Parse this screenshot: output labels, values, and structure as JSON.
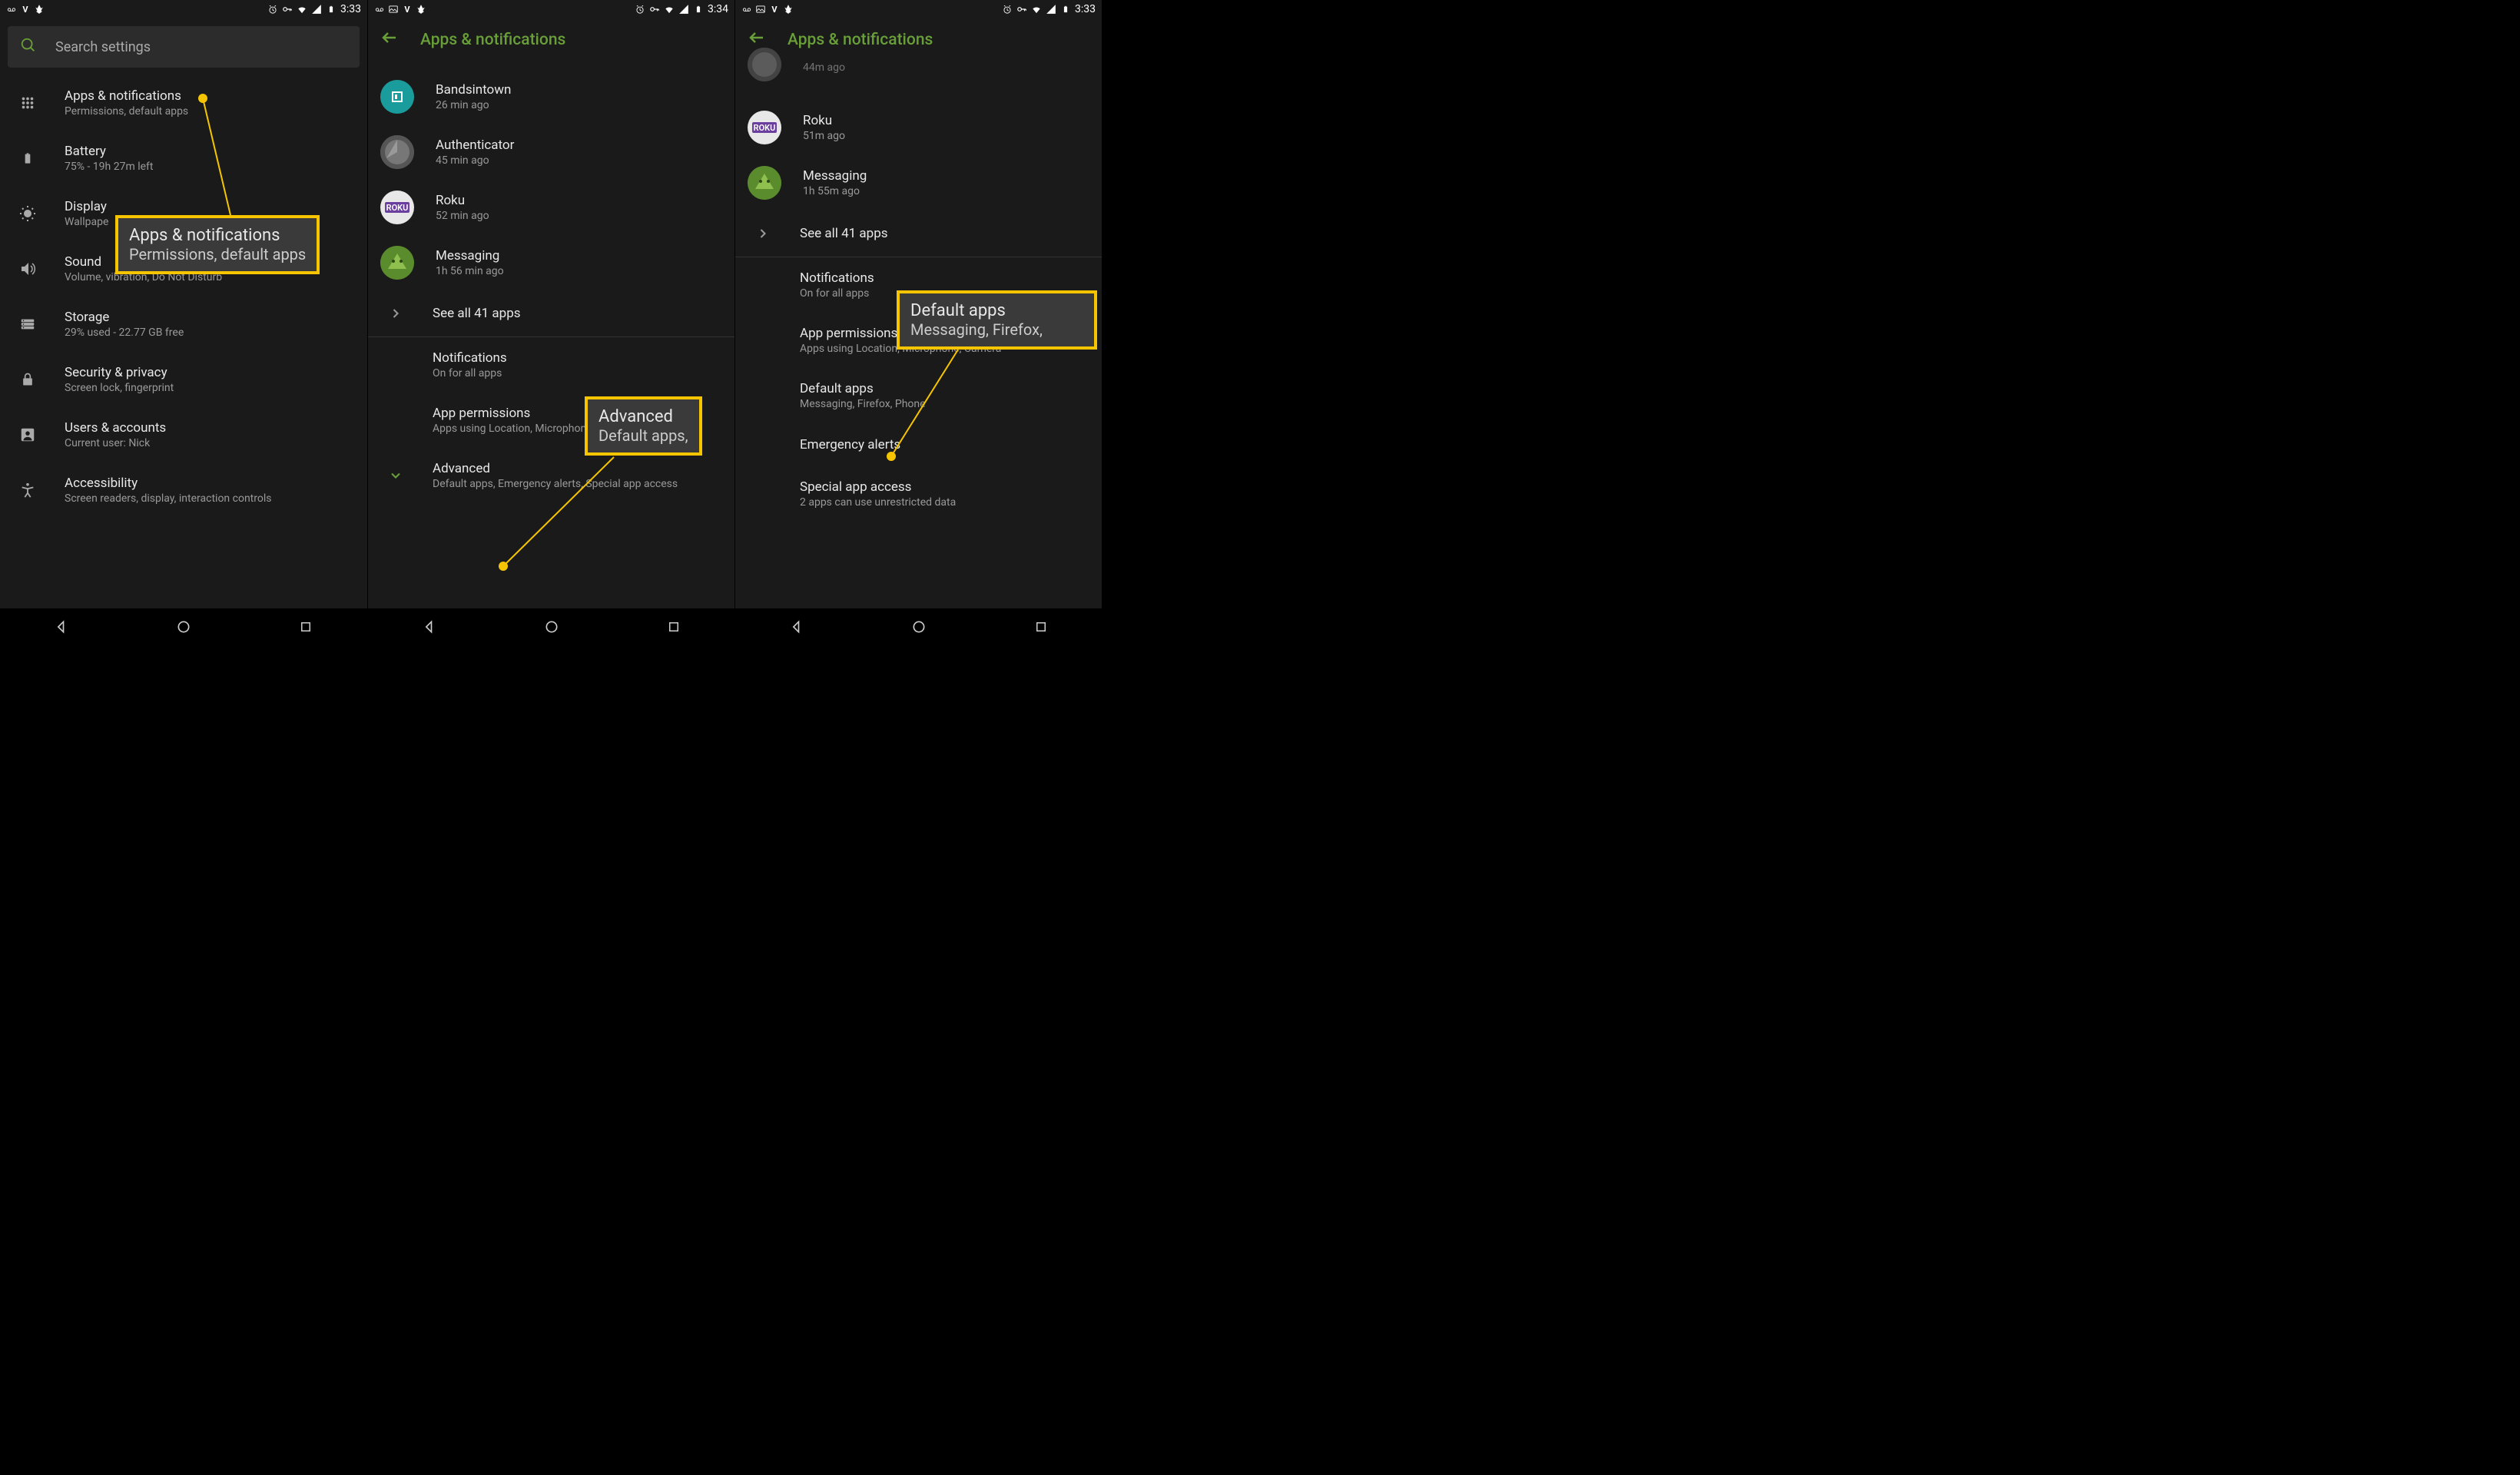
{
  "screens": [
    {
      "status": {
        "time": "3:33",
        "left_icons": [
          "voicemail",
          "v",
          "leaf"
        ],
        "right_icons": [
          "alarm",
          "key",
          "wifi",
          "signal",
          "battery"
        ]
      },
      "search_placeholder": "Search settings",
      "items": [
        {
          "icon": "grid",
          "title": "Apps & notifications",
          "sub": "Permissions, default apps"
        },
        {
          "icon": "battery",
          "title": "Battery",
          "sub": "75% - 19h 27m left"
        },
        {
          "icon": "brightness",
          "title": "Display",
          "sub": "Wallpape"
        },
        {
          "icon": "volume",
          "title": "Sound",
          "sub": "Volume, vibration, Do Not Disturb"
        },
        {
          "icon": "storage",
          "title": "Storage",
          "sub": "29% used - 22.77 GB free"
        },
        {
          "icon": "lock",
          "title": "Security & privacy",
          "sub": "Screen lock, fingerprint"
        },
        {
          "icon": "user",
          "title": "Users & accounts",
          "sub": "Current user: Nick"
        },
        {
          "icon": "accessibility",
          "title": "Accessibility",
          "sub": "Screen readers, display, interaction controls"
        }
      ],
      "callout": {
        "title": "Apps & notifications",
        "sub": "Permissions, default apps"
      }
    },
    {
      "status": {
        "time": "3:34",
        "left_icons": [
          "voicemail",
          "picture",
          "v",
          "leaf"
        ],
        "right_icons": [
          "alarm",
          "key",
          "wifi",
          "signal",
          "battery"
        ]
      },
      "header_title": "Apps & notifications",
      "truncated_sub": "",
      "apps": [
        {
          "name": "Bandsintown",
          "sub": "26 min ago",
          "icon": "bit"
        },
        {
          "name": "Authenticator",
          "sub": "45 min ago",
          "icon": "auth"
        },
        {
          "name": "Roku",
          "sub": "52 min ago",
          "icon": "roku"
        },
        {
          "name": "Messaging",
          "sub": "1h 56 min ago",
          "icon": "msg"
        }
      ],
      "see_all": "See all 41 apps",
      "sections": [
        {
          "title": "Notifications",
          "sub": "On for all apps"
        },
        {
          "title": "App permissions",
          "sub": "Apps using Location, Microphone, Camera"
        }
      ],
      "advanced": {
        "title": "Advanced",
        "sub": "Default apps, Emergency alerts, Special app access"
      },
      "callout": {
        "title": "Advanced",
        "sub": "Default apps,"
      }
    },
    {
      "status": {
        "time": "3:33",
        "left_icons": [
          "voicemail",
          "picture",
          "v",
          "leaf"
        ],
        "right_icons": [
          "alarm",
          "key",
          "wifi",
          "signal",
          "battery"
        ]
      },
      "header_title": "Apps & notifications",
      "truncated_title": "",
      "truncated_sub": "44m ago",
      "apps": [
        {
          "name": "Roku",
          "sub": "51m ago",
          "icon": "roku"
        },
        {
          "name": "Messaging",
          "sub": "1h 55m ago",
          "icon": "msg"
        }
      ],
      "see_all": "See all 41 apps",
      "sections": [
        {
          "title": "Notifications",
          "sub": "On for all apps"
        },
        {
          "title": "App permissions",
          "sub": "Apps using Location, Microphone, Camera"
        },
        {
          "title": "Default apps",
          "sub": "Messaging, Firefox, Phone"
        },
        {
          "title": "Emergency alerts",
          "sub": ""
        },
        {
          "title": "Special app access",
          "sub": "2 apps can use unrestricted data"
        }
      ],
      "callout": {
        "title": "Default apps",
        "sub": "Messaging, Firefox,"
      }
    }
  ]
}
